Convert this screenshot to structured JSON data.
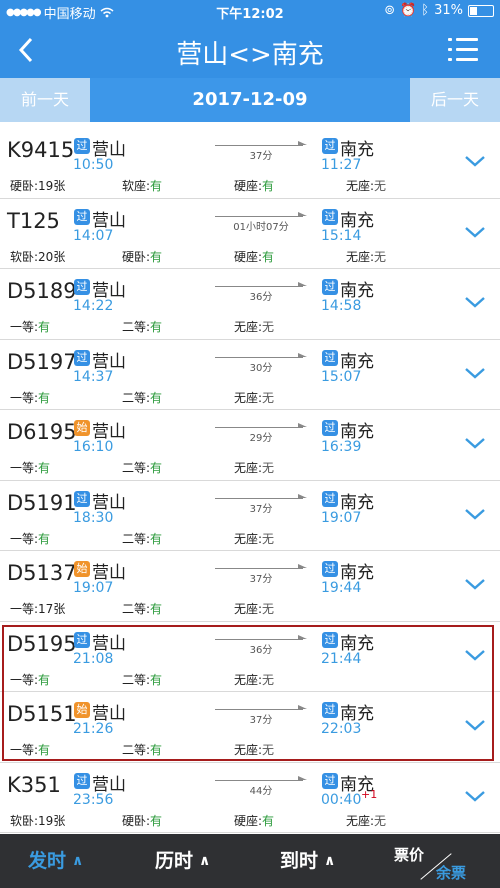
{
  "status_bar": {
    "carrier": "中国移动",
    "time": "下午12:02",
    "battery_label": "31%",
    "battery_level": 0.31,
    "icons": [
      "signal-icon",
      "wifi-icon",
      "orientation-lock-icon",
      "alarm-icon",
      "bluetooth-icon",
      "battery-icon"
    ]
  },
  "nav": {
    "title": "营山<>南充",
    "back_icon": "chevron-left-icon",
    "menu_icon": "list-menu-icon"
  },
  "date_bar": {
    "prev_label": "前一天",
    "date": "2017-12-09",
    "next_label": "后一天"
  },
  "colors": {
    "primary": "#3590e4",
    "time_blue": "#3a9be0",
    "available_green": "#2a9a3a",
    "pass_badge": "#3590e4",
    "start_badge": "#f0932b",
    "highlight_border": "#a61c1c",
    "bottom_bar": "#2f3033"
  },
  "trains": [
    {
      "no": "K9415",
      "dep_badge": "过",
      "dep_badge_type": "pass",
      "from": "营山",
      "dep_time": "10:50",
      "duration": "37分",
      "arr_badge": "过",
      "to": "南充",
      "arr_time": "11:27",
      "plus_day": "",
      "seats": [
        {
          "label": "硬卧:",
          "value": "19张",
          "status": "text"
        },
        {
          "label": "软座:",
          "value": "有",
          "status": "ok"
        },
        {
          "label": "硬座:",
          "value": "有",
          "status": "ok"
        },
        {
          "label": "无座:",
          "value": "无",
          "status": "no"
        }
      ]
    },
    {
      "no": "T125",
      "dep_badge": "过",
      "dep_badge_type": "pass",
      "from": "营山",
      "dep_time": "14:07",
      "duration": "01小时07分",
      "arr_badge": "过",
      "to": "南充",
      "arr_time": "15:14",
      "plus_day": "",
      "seats": [
        {
          "label": "软卧:",
          "value": "20张",
          "status": "text"
        },
        {
          "label": "硬卧:",
          "value": "有",
          "status": "ok"
        },
        {
          "label": "硬座:",
          "value": "有",
          "status": "ok"
        },
        {
          "label": "无座:",
          "value": "无",
          "status": "no"
        }
      ]
    },
    {
      "no": "D5189",
      "dep_badge": "过",
      "dep_badge_type": "pass",
      "from": "营山",
      "dep_time": "14:22",
      "duration": "36分",
      "arr_badge": "过",
      "to": "南充",
      "arr_time": "14:58",
      "plus_day": "",
      "seats": [
        {
          "label": "一等:",
          "value": "有",
          "status": "ok"
        },
        {
          "label": "二等:",
          "value": "有",
          "status": "ok"
        },
        {
          "label": "无座:",
          "value": "无",
          "status": "no"
        }
      ]
    },
    {
      "no": "D5197",
      "dep_badge": "过",
      "dep_badge_type": "pass",
      "from": "营山",
      "dep_time": "14:37",
      "duration": "30分",
      "arr_badge": "过",
      "to": "南充",
      "arr_time": "15:07",
      "plus_day": "",
      "seats": [
        {
          "label": "一等:",
          "value": "有",
          "status": "ok"
        },
        {
          "label": "二等:",
          "value": "有",
          "status": "ok"
        },
        {
          "label": "无座:",
          "value": "无",
          "status": "no"
        }
      ]
    },
    {
      "no": "D6195",
      "dep_badge": "始",
      "dep_badge_type": "start",
      "from": "营山",
      "dep_time": "16:10",
      "duration": "29分",
      "arr_badge": "过",
      "to": "南充",
      "arr_time": "16:39",
      "plus_day": "",
      "seats": [
        {
          "label": "一等:",
          "value": "有",
          "status": "ok"
        },
        {
          "label": "二等:",
          "value": "有",
          "status": "ok"
        },
        {
          "label": "无座:",
          "value": "无",
          "status": "no"
        }
      ]
    },
    {
      "no": "D5191",
      "dep_badge": "过",
      "dep_badge_type": "pass",
      "from": "营山",
      "dep_time": "18:30",
      "duration": "37分",
      "arr_badge": "过",
      "to": "南充",
      "arr_time": "19:07",
      "plus_day": "",
      "seats": [
        {
          "label": "一等:",
          "value": "有",
          "status": "ok"
        },
        {
          "label": "二等:",
          "value": "有",
          "status": "ok"
        },
        {
          "label": "无座:",
          "value": "无",
          "status": "no"
        }
      ]
    },
    {
      "no": "D5137",
      "dep_badge": "始",
      "dep_badge_type": "start",
      "from": "营山",
      "dep_time": "19:07",
      "duration": "37分",
      "arr_badge": "过",
      "to": "南充",
      "arr_time": "19:44",
      "plus_day": "",
      "seats": [
        {
          "label": "一等:",
          "value": "17张",
          "status": "text"
        },
        {
          "label": "二等:",
          "value": "有",
          "status": "ok"
        },
        {
          "label": "无座:",
          "value": "无",
          "status": "no"
        }
      ]
    },
    {
      "no": "D5195",
      "dep_badge": "过",
      "dep_badge_type": "pass",
      "from": "营山",
      "dep_time": "21:08",
      "duration": "36分",
      "arr_badge": "过",
      "to": "南充",
      "arr_time": "21:44",
      "plus_day": "",
      "seats": [
        {
          "label": "一等:",
          "value": "有",
          "status": "ok"
        },
        {
          "label": "二等:",
          "value": "有",
          "status": "ok"
        },
        {
          "label": "无座:",
          "value": "无",
          "status": "no"
        }
      ]
    },
    {
      "no": "D5151",
      "dep_badge": "始",
      "dep_badge_type": "start",
      "from": "营山",
      "dep_time": "21:26",
      "duration": "37分",
      "arr_badge": "过",
      "to": "南充",
      "arr_time": "22:03",
      "plus_day": "",
      "seats": [
        {
          "label": "一等:",
          "value": "有",
          "status": "ok"
        },
        {
          "label": "二等:",
          "value": "有",
          "status": "ok"
        },
        {
          "label": "无座:",
          "value": "无",
          "status": "no"
        }
      ]
    },
    {
      "no": "K351",
      "dep_badge": "过",
      "dep_badge_type": "pass",
      "from": "营山",
      "dep_time": "23:56",
      "duration": "44分",
      "arr_badge": "过",
      "to": "南充",
      "arr_time": "00:40",
      "plus_day": "+1",
      "seats": [
        {
          "label": "软卧:",
          "value": "19张",
          "status": "text"
        },
        {
          "label": "硬卧:",
          "value": "有",
          "status": "ok"
        },
        {
          "label": "硬座:",
          "value": "有",
          "status": "ok"
        },
        {
          "label": "无座:",
          "value": "无",
          "status": "no"
        }
      ]
    }
  ],
  "bottom_bar": {
    "tabs": [
      {
        "label": "发时",
        "active": true
      },
      {
        "label": "历时",
        "active": false
      },
      {
        "label": "到时",
        "active": false
      }
    ],
    "price_label": "票价",
    "remaining_label": "余票"
  }
}
